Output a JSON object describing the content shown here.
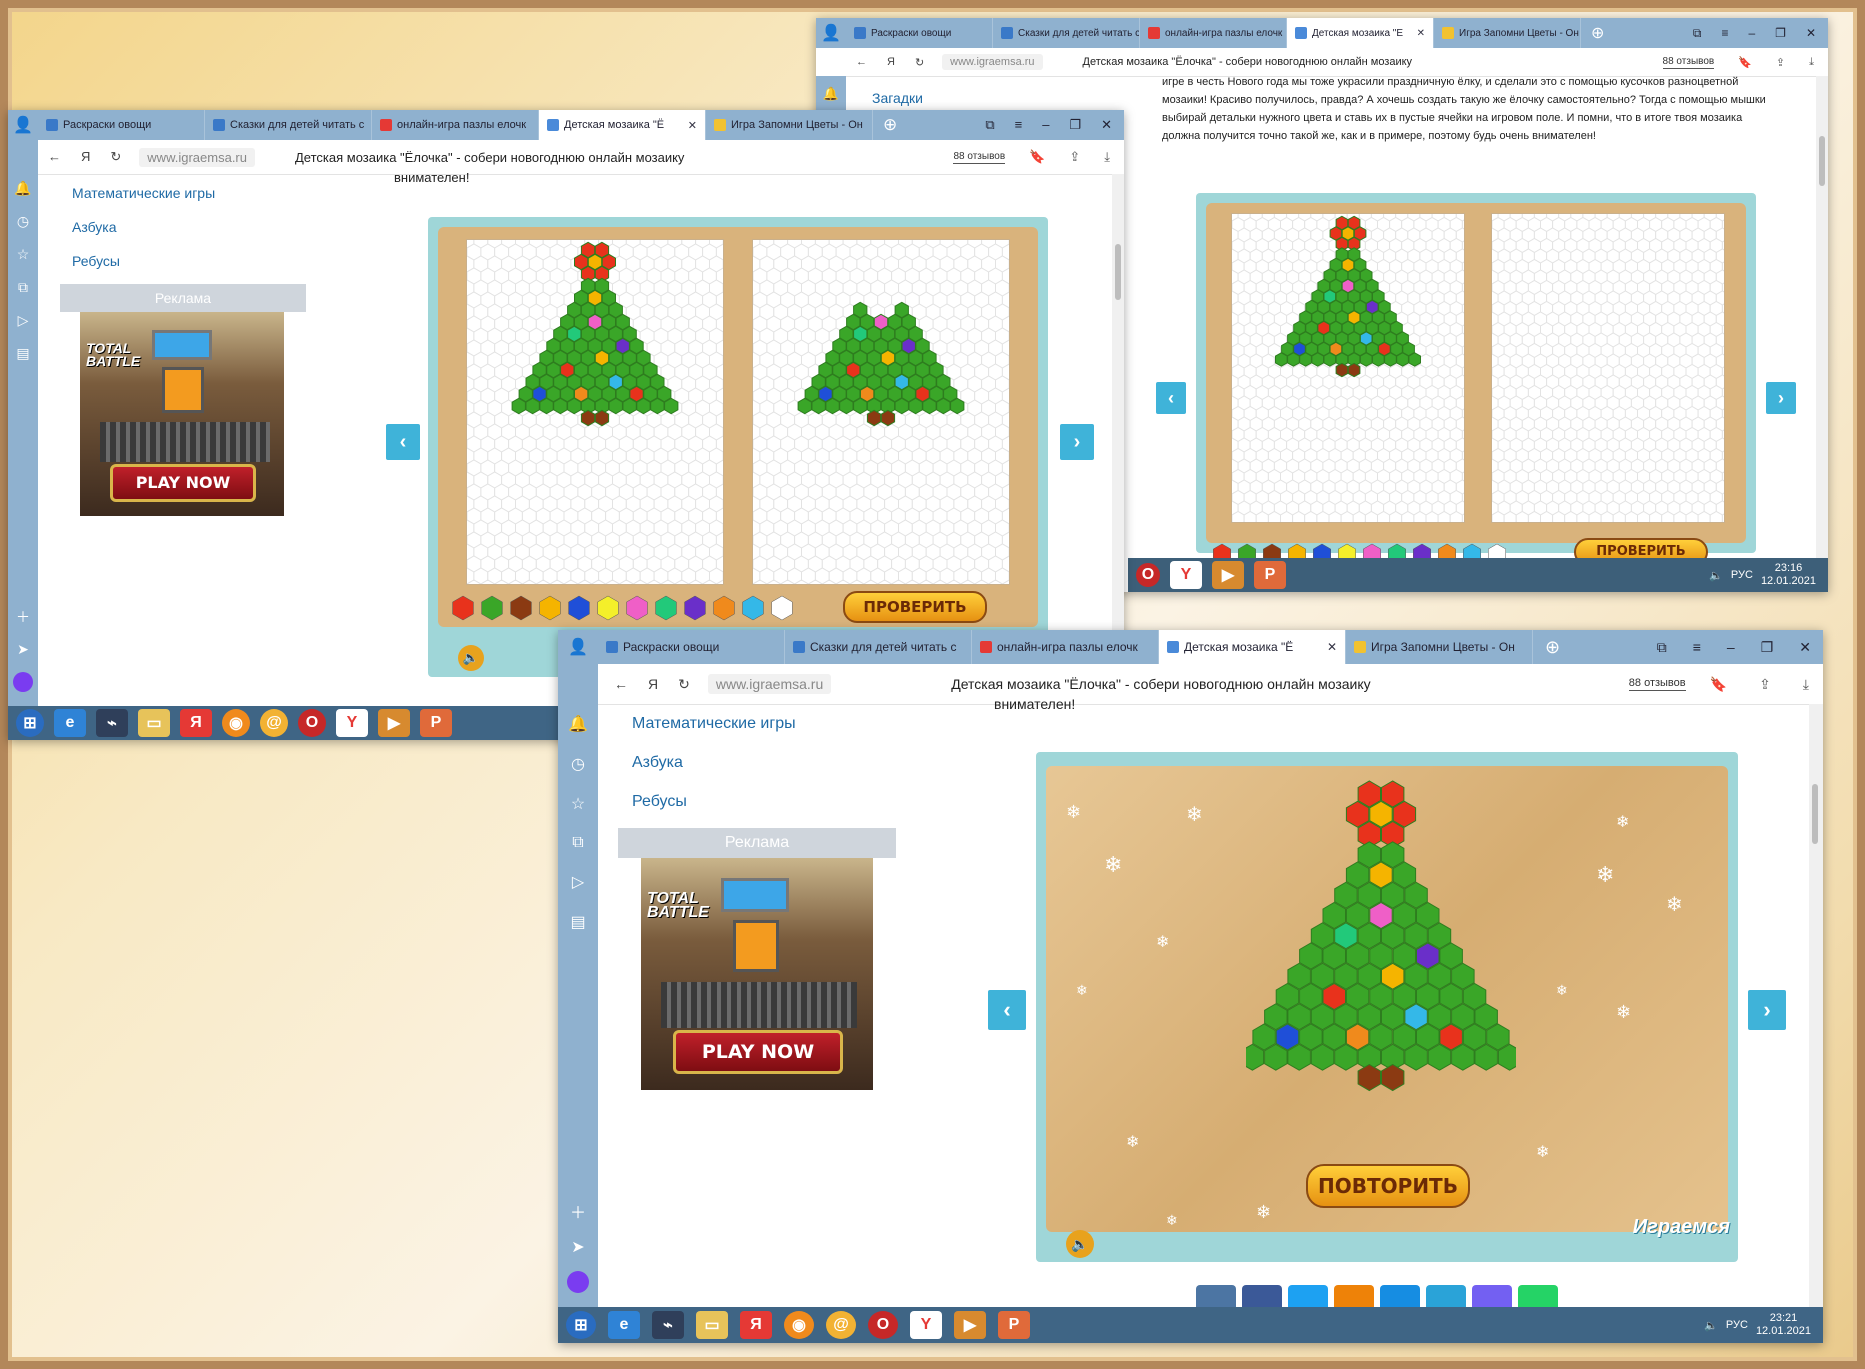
{
  "tabs": [
    {
      "label": "Раскраски овощи",
      "favicon_color": "#3a79c8"
    },
    {
      "label": "Сказки для детей читать с",
      "favicon_color": "#3a79c8"
    },
    {
      "label": "онлайн-игра пазлы елочк",
      "favicon_color": "#e53935"
    },
    {
      "label": "Детская мозаика \"Ё",
      "favicon_color": "#4a8ad9",
      "active": true
    },
    {
      "label": "Игра Запомни Цветы - Он",
      "favicon_color": "#f2c230"
    }
  ],
  "tabs_small": [
    "Раскраски овощи",
    "Сказки для детей читать с",
    "онлайн-игра пазлы елочк",
    "Детская мозаика \"Е",
    "Игра Запомни Цветы - Он"
  ],
  "address": {
    "url": "www.igraemsa.ru",
    "title": "Детская мозаика \"Ёлочка\" - собери новогоднюю онлайн мозаику",
    "reviews": "88 отзывов"
  },
  "sidebar_menu": [
    "Математические игры",
    "Азбука",
    "Ребусы"
  ],
  "sidebar_menu_topright": "Загадки",
  "ad": {
    "label": "Реклама",
    "brand": "TOTAL BATTLE",
    "cta": "PLAY NOW"
  },
  "text_attentive": "внимателен!",
  "intro_text": "игре в честь Нового года мы тоже украсили праздничную ёлку, и сделали это с помощью кусочков разноцветной мозаики! Красиво получилось, правда? А хочешь создать такую же ёлочку самостоятельно? Тогда с помощью мышки выбирай детальки нужного цвета и ставь их в пустые ячейки на игровом поле. И помни, что в итоге твоя мозаика должна получится точно такой же, как и в примере, поэтому будь очень внимателен!",
  "game": {
    "check_button": "ПРОВЕРИТЬ",
    "repeat_button": "ПОВТОРИТЬ",
    "brand_logo": "Играемся",
    "palette": [
      "#e8321c",
      "#3aa628",
      "#8b3a12",
      "#f5b400",
      "#1f4fd8",
      "#f4ef2a",
      "#ef5fc7",
      "#22c97a",
      "#6a2fc9",
      "#f08a1c",
      "#34b8e8",
      "#ffffff"
    ]
  },
  "taskbar": {
    "lang": "РУС",
    "time_top": "23:16",
    "time_bottom": "23:21",
    "date": "12.01.2021"
  },
  "colors": {
    "accent": "#3fb3d9",
    "sidebar": "#8fb1cf",
    "link": "#1f6aa5"
  }
}
